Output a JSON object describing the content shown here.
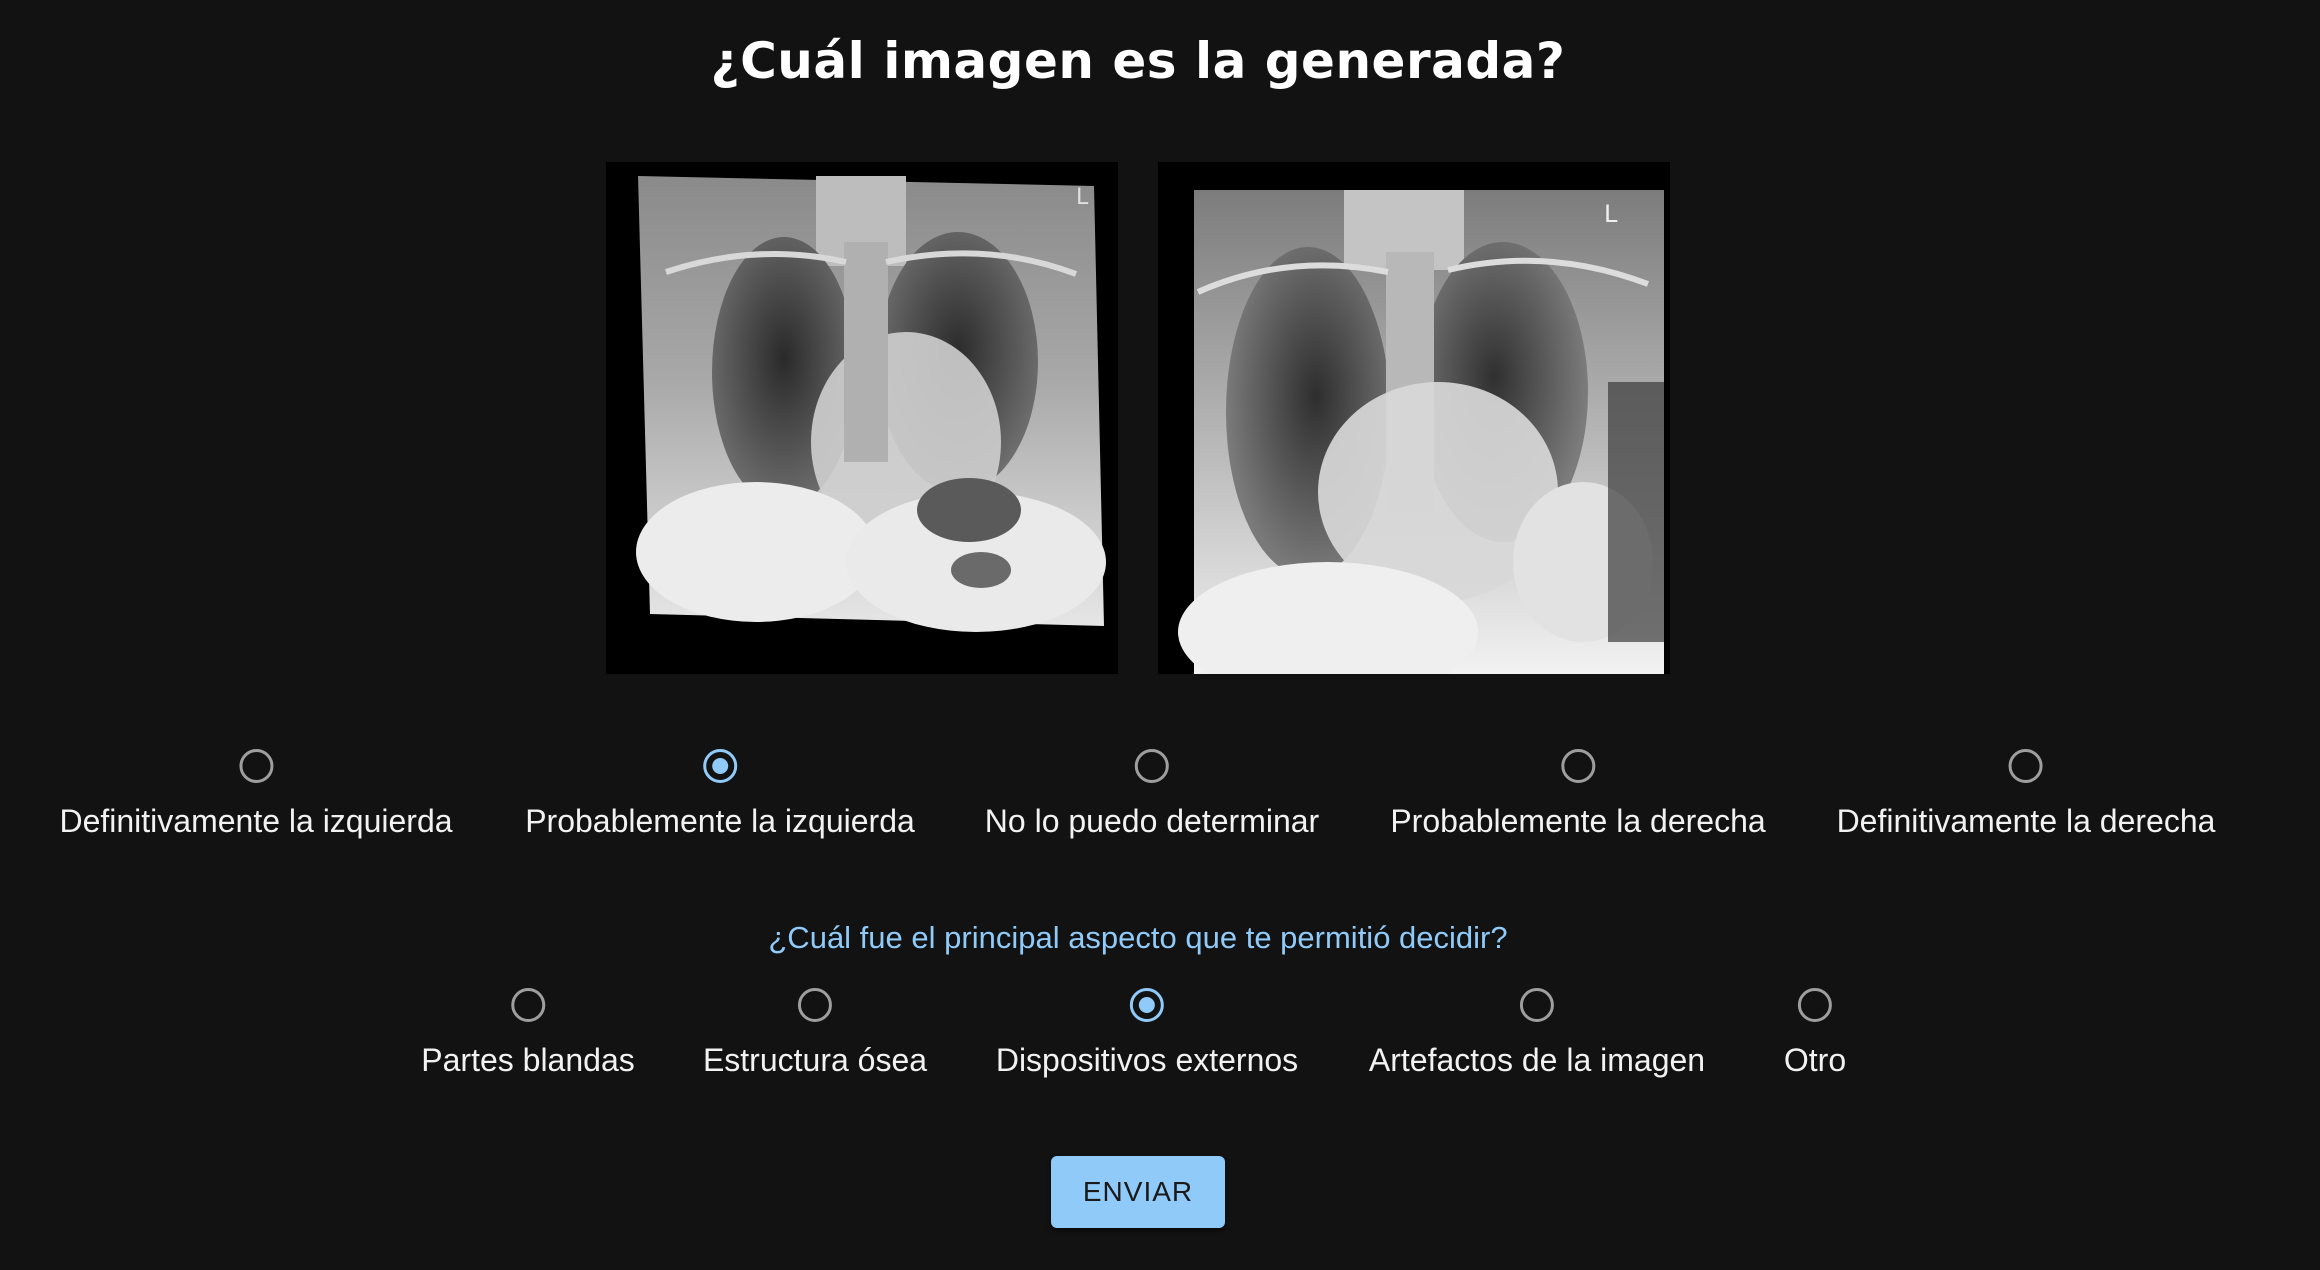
{
  "header": {
    "title": "¿Cuál imagen es la generada?"
  },
  "images": {
    "left": {
      "icon": "chest-xray-image",
      "marker": "L"
    },
    "right": {
      "icon": "chest-xray-image",
      "marker": "L"
    }
  },
  "question1": {
    "selected_index": 1,
    "options": [
      "Definitivamente la izquierda",
      "Probablemente la izquierda",
      "No lo puedo determinar",
      "Probablemente la derecha",
      "Definitivamente la derecha"
    ]
  },
  "question2": {
    "prompt": "¿Cuál fue el principal aspecto que te permitió decidir?",
    "selected_index": 2,
    "options": [
      "Partes blandas",
      "Estructura ósea",
      "Dispositivos externos",
      "Artefactos de la imagen",
      "Otro"
    ]
  },
  "submit": {
    "label": "ENVIAR"
  },
  "colors": {
    "background": "#121212",
    "accent": "#90caf9",
    "radio_unchecked": "#9e9e9e",
    "text": "#ffffff"
  }
}
